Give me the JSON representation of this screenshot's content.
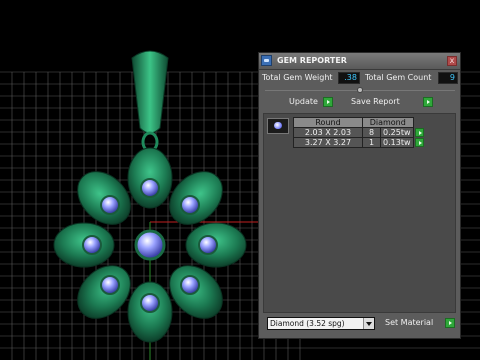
{
  "panel": {
    "title": "GEM REPORTER",
    "close_glyph": "x",
    "total_weight_label": "Total Gem Weight",
    "total_weight_value": ".38",
    "total_count_label": "Total Gem Count",
    "total_count_value": "9",
    "update_label": "Update",
    "save_report_label": "Save Report",
    "table": {
      "headers": [
        "Round",
        "Diamond"
      ],
      "rows": [
        {
          "size": "2.03 X 2.03",
          "count": "8",
          "tw": "0.25tw"
        },
        {
          "size": "3.27 X 3.27",
          "count": "1",
          "tw": "0.13tw"
        }
      ]
    },
    "material_select_value": "Diamond   (3.52 spg)",
    "set_material_label": "Set Material"
  },
  "colors": {
    "metal": "#1f8a5c",
    "gem": "#7d86ff",
    "accent_green": "#2fa83a",
    "value_cyan": "#41c9ff"
  },
  "icons": [
    "gem-reporter-app-icon",
    "close-icon",
    "go-arrow-icon",
    "round-gem-icon",
    "dropdown-arrow-icon"
  ]
}
